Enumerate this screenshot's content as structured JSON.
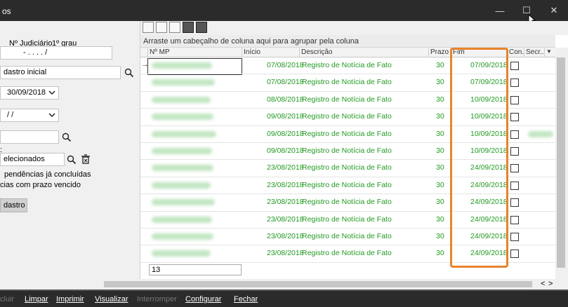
{
  "window": {
    "title": "os",
    "minimize_glyph": "—",
    "maximize_glyph": "☐",
    "close_glyph": "✕"
  },
  "left_panel": {
    "judicial_label": "Nº Judiciário",
    "grau_label": "1º grau",
    "judicial_value": "- .   . . .   /",
    "cadastro_value": "dastro inicial",
    "date_value": "30/09/2018",
    "date2_value": " / /",
    "selecionados_value": "elecionados",
    "colon": ":",
    "check1_label": "pendências já concluídas",
    "check2_label": "cias com prazo vencido",
    "button_label": "dastro"
  },
  "grid": {
    "group_hint": "Arraste um cabeçalho de coluna aqui para agrupar pela coluna",
    "columns": [
      "Nº MP",
      "Início",
      "Descrição",
      "Prazo",
      "Fim",
      "Con...",
      "Secr..."
    ],
    "dropdown_glyph": "▼",
    "row_marker": "→",
    "rows": [
      {
        "inicio": "07/08/2018",
        "descricao": "Registro de Notícia de Fato",
        "prazo": "30",
        "fim": "07/09/2018"
      },
      {
        "inicio": "07/08/2018",
        "descricao": "Registro de Notícia de Fato",
        "prazo": "30",
        "fim": "07/09/2018"
      },
      {
        "inicio": "08/08/2018",
        "descricao": "Registro de Notícia de Fato",
        "prazo": "30",
        "fim": "10/09/2018"
      },
      {
        "inicio": "09/08/2018",
        "descricao": "Registro de Notícia de Fato",
        "prazo": "30",
        "fim": "10/09/2018"
      },
      {
        "inicio": "09/08/2018",
        "descricao": "Registro de Notícia de Fato",
        "prazo": "30",
        "fim": "10/09/2018"
      },
      {
        "inicio": "09/08/2018",
        "descricao": "Registro de Notícia de Fato",
        "prazo": "30",
        "fim": "10/09/2018"
      },
      {
        "inicio": "23/08/2018",
        "descricao": "Registro de Notícia de Fato",
        "prazo": "30",
        "fim": "24/09/2018"
      },
      {
        "inicio": "23/08/2018",
        "descricao": "Registro de Notícia de Fato",
        "prazo": "30",
        "fim": "24/09/2018"
      },
      {
        "inicio": "23/08/2018",
        "descricao": "Registro de Notícia de Fato",
        "prazo": "30",
        "fim": "24/09/2018"
      },
      {
        "inicio": "23/08/2018",
        "descricao": "Registro de Notícia de Fato",
        "prazo": "30",
        "fim": "24/09/2018"
      },
      {
        "inicio": "23/08/2018",
        "descricao": "Registro de Notícia de Fato",
        "prazo": "30",
        "fim": "24/09/2018"
      },
      {
        "inicio": "23/08/2018",
        "descricao": "Registro de Notícia de Fato",
        "prazo": "30",
        "fim": "24/09/2018"
      }
    ],
    "count": "13",
    "scroll_glyphs": {
      "left": "<",
      "right": ">"
    }
  },
  "bottom_bar": {
    "excluir": "cluir",
    "limpar": "Limpar",
    "imprimir": "Imprimir",
    "visualizar": "Visualizar",
    "interromper": "Interromper",
    "configurar": "Configurar",
    "fechar": "Fechar"
  },
  "colors": {
    "accent_text": "#229922",
    "highlight_box": "#e8832a",
    "title_bar": "#2b2b2b"
  }
}
